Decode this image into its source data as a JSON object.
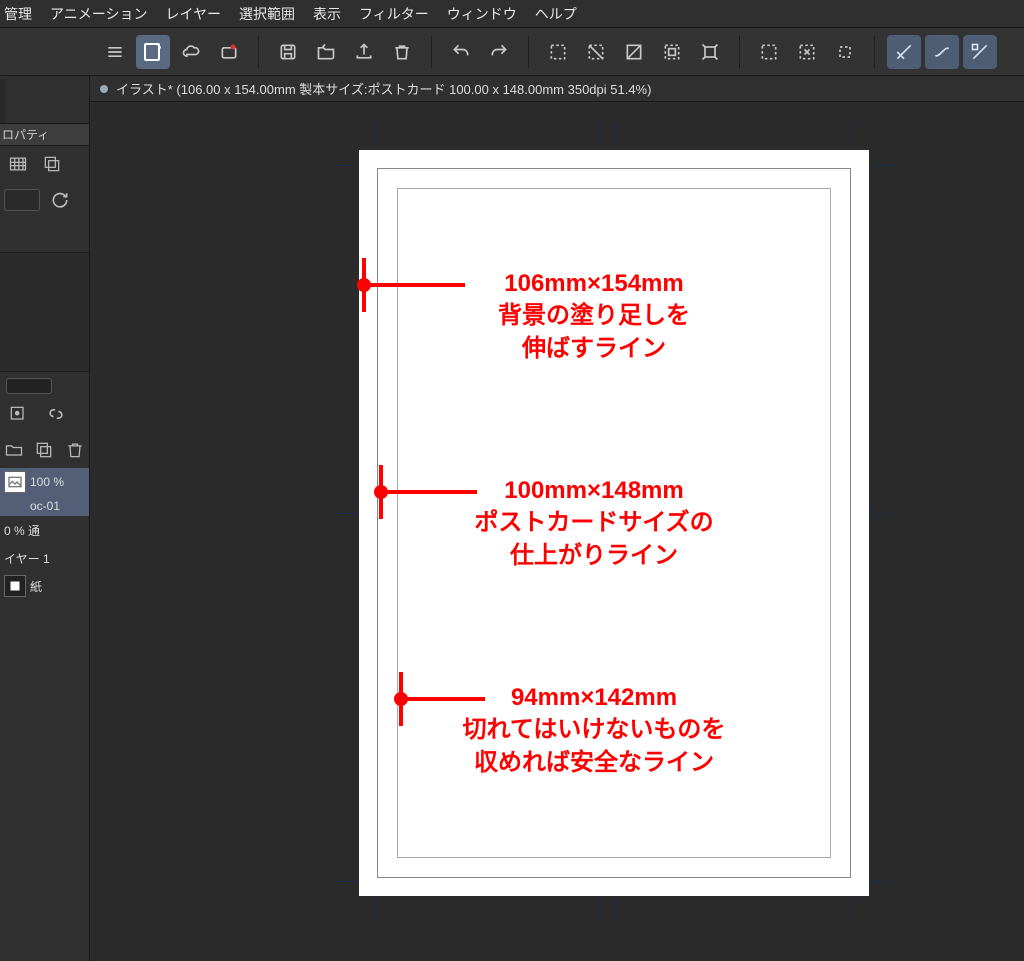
{
  "menu": {
    "items": [
      "管理",
      "アニメーション",
      "レイヤー",
      "選択範囲",
      "表示",
      "フィルター",
      "ウィンドウ",
      "ヘルプ"
    ]
  },
  "doc_tab": {
    "title": "イラスト* (106.00 x 154.00mm 製本サイズ:ポストカード 100.00 x 148.00mm 350dpi 51.4%)"
  },
  "left": {
    "prop_tab": "ロパティ",
    "layer_header": "",
    "layer1_percent": "100 %",
    "layer1_id": "oc-01",
    "opacity_label": "0 %  通",
    "layer_name": "イヤー 1",
    "paper": "紙"
  },
  "annotations": {
    "bleed": {
      "size": "106mm×154mm",
      "l2": "背景の塗り足しを",
      "l3": "伸ばすライン"
    },
    "trim": {
      "size": "100mm×148mm",
      "l2": "ポストカードサイズの",
      "l3": "仕上がりライン"
    },
    "safe": {
      "size": "94mm×142mm",
      "l2": "切れてはいけないものを",
      "l3": "収めれば安全なライン"
    }
  }
}
